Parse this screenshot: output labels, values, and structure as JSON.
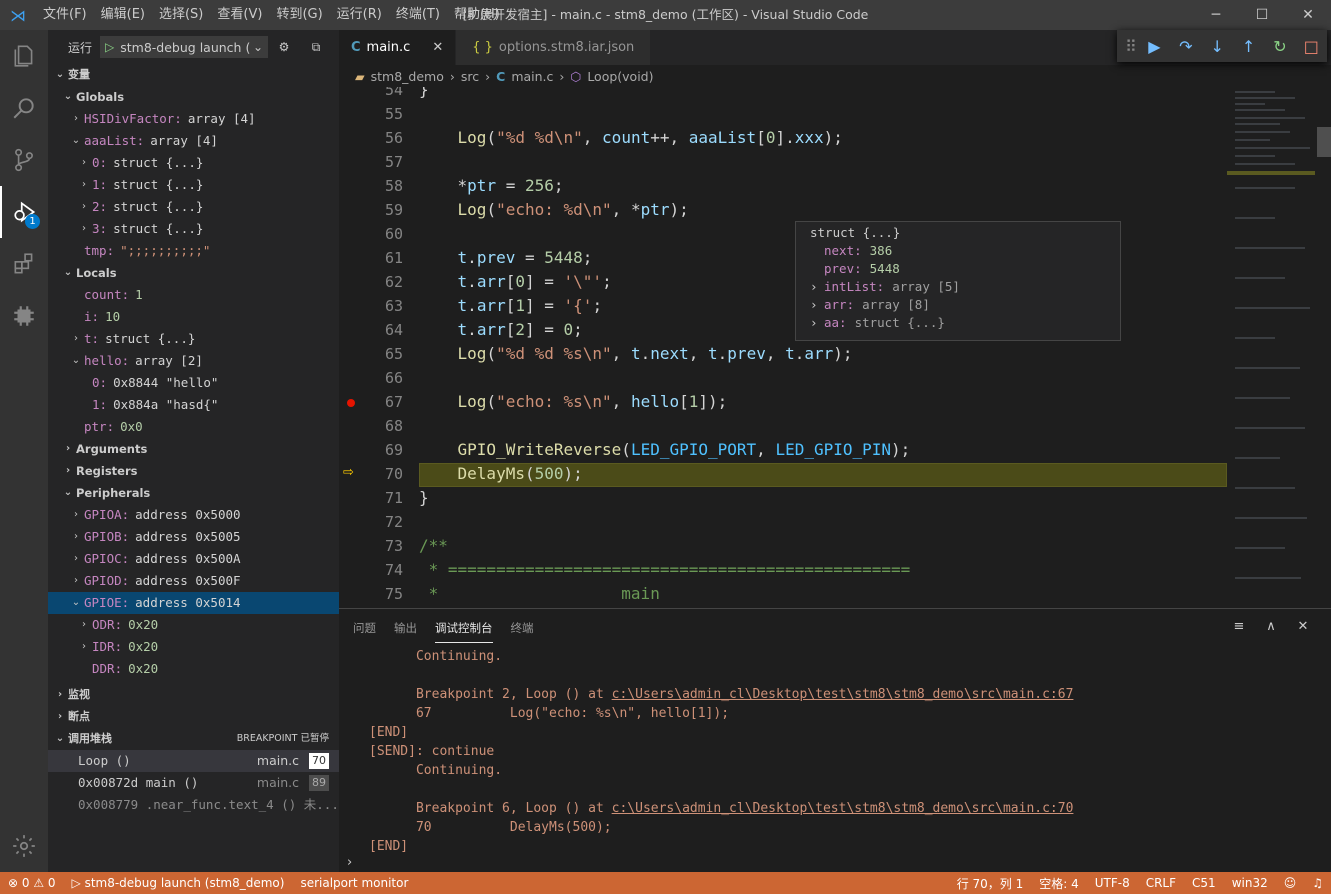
{
  "menu": [
    "文件(F)",
    "编辑(E)",
    "选择(S)",
    "查看(V)",
    "转到(G)",
    "运行(R)",
    "终端(T)",
    "帮助(H)"
  ],
  "window_title": "[扩展开发宿主] - main.c - stm8_demo (工作区) - Visual Studio Code",
  "activity_badge": "1",
  "run": {
    "label": "运行",
    "config": "stm8-debug launch ("
  },
  "variables": {
    "header": "变量",
    "rows": [
      {
        "chev": "⌄",
        "indent": 0,
        "type": "grp",
        "name": "Globals"
      },
      {
        "chev": "›",
        "indent": 1,
        "name": "HSIDivFactor:",
        "value": "array [4]"
      },
      {
        "chev": "⌄",
        "indent": 1,
        "name": "aaaList:",
        "value": "array [4]"
      },
      {
        "chev": "›",
        "indent": 2,
        "name": "0:",
        "value": "struct {...}"
      },
      {
        "chev": "›",
        "indent": 2,
        "name": "1:",
        "value": "struct {...}"
      },
      {
        "chev": "›",
        "indent": 2,
        "name": "2:",
        "value": "struct {...}"
      },
      {
        "chev": "›",
        "indent": 2,
        "name": "3:",
        "value": "struct {...}"
      },
      {
        "chev": "",
        "indent": 1,
        "name": "tmp:",
        "value": "\";;;;;;;;;;\"",
        "vc": "str"
      },
      {
        "chev": "⌄",
        "indent": 0,
        "type": "grp",
        "name": "Locals"
      },
      {
        "chev": "",
        "indent": 1,
        "name": "count:",
        "value": "1",
        "vc": "num"
      },
      {
        "chev": "",
        "indent": 1,
        "name": "i:",
        "value": "10",
        "vc": "num"
      },
      {
        "chev": "›",
        "indent": 1,
        "name": "t:",
        "value": "struct {...}"
      },
      {
        "chev": "⌄",
        "indent": 1,
        "name": "hello:",
        "value": "array [2]"
      },
      {
        "chev": "",
        "indent": 2,
        "name": "0:",
        "value": "0x8844 \"hello\""
      },
      {
        "chev": "",
        "indent": 2,
        "name": "1:",
        "value": "0x884a \"hasd{\""
      },
      {
        "chev": "",
        "indent": 1,
        "name": "ptr:",
        "value": "0x0",
        "vc": "num"
      },
      {
        "chev": "›",
        "indent": 0,
        "type": "grp",
        "name": "Arguments"
      },
      {
        "chev": "›",
        "indent": 0,
        "type": "grp",
        "name": "Registers"
      },
      {
        "chev": "⌄",
        "indent": 0,
        "type": "grp",
        "name": "Peripherals"
      },
      {
        "chev": "›",
        "indent": 1,
        "name": "GPIOA:",
        "value": "address 0x5000"
      },
      {
        "chev": "›",
        "indent": 1,
        "name": "GPIOB:",
        "value": "address 0x5005"
      },
      {
        "chev": "›",
        "indent": 1,
        "name": "GPIOC:",
        "value": "address 0x500A"
      },
      {
        "chev": "›",
        "indent": 1,
        "name": "GPIOD:",
        "value": "address 0x500F"
      },
      {
        "chev": "⌄",
        "indent": 1,
        "name": "GPIOE:",
        "value": "address 0x5014",
        "sel": true
      },
      {
        "chev": "›",
        "indent": 2,
        "name": "ODR:",
        "value": "0x20",
        "vc": "num"
      },
      {
        "chev": "›",
        "indent": 2,
        "name": "IDR:",
        "value": "0x20",
        "vc": "num"
      },
      {
        "chev": "",
        "indent": 2,
        "name": "DDR:",
        "value": "0x20",
        "vc": "num"
      }
    ]
  },
  "watch_header": "监视",
  "breakpoints_header": "断点",
  "callstack": {
    "header": "调用堆栈",
    "status": "BREAKPOINT 已暂停",
    "frames": [
      {
        "name": "Loop ()",
        "file": "main.c",
        "line": "70"
      },
      {
        "name": "0x00872d main ()",
        "file": "main.c",
        "line": "89"
      },
      {
        "name": "0x008779 .near_func.text_4 () 未...",
        "file": "",
        "line": ""
      }
    ]
  },
  "tabs": [
    {
      "label": "main.c",
      "icon": "C",
      "active": true
    },
    {
      "label": "options.stm8.iar.json",
      "icon": "{ }",
      "active": false
    }
  ],
  "breadcrumb": [
    "stm8_demo",
    "src",
    "main.c",
    "Loop(void)"
  ],
  "code_lines": [
    {
      "n": "54",
      "t": "}"
    },
    {
      "n": "55",
      "t": ""
    },
    {
      "n": "56",
      "t": "    Log(\"%d %d\\n\", count++, aaaList[0].xxx);"
    },
    {
      "n": "57",
      "t": ""
    },
    {
      "n": "58",
      "t": "    *ptr = 256;"
    },
    {
      "n": "59",
      "t": "    Log(\"echo: %d\\n\", *ptr);"
    },
    {
      "n": "60",
      "t": ""
    },
    {
      "n": "61",
      "t": "    t.prev = 5448;"
    },
    {
      "n": "62",
      "t": "    t.arr[0] = '\\\"';"
    },
    {
      "n": "63",
      "t": "    t.arr[1] = '{';"
    },
    {
      "n": "64",
      "t": "    t.arr[2] = 0;"
    },
    {
      "n": "65",
      "t": "    Log(\"%d %d %s\\n\", t.next, t.prev, t.arr);"
    },
    {
      "n": "66",
      "t": ""
    },
    {
      "n": "67",
      "t": "    Log(\"echo: %s\\n\", hello[1]);",
      "bp": true
    },
    {
      "n": "68",
      "t": ""
    },
    {
      "n": "69",
      "t": "    GPIO_WriteReverse(LED_GPIO_PORT, LED_GPIO_PIN);"
    },
    {
      "n": "70",
      "t": "    DelayMs(500);",
      "cur": true
    },
    {
      "n": "71",
      "t": "}"
    },
    {
      "n": "72",
      "t": ""
    },
    {
      "n": "73",
      "t": "/**"
    },
    {
      "n": "74",
      "t": " * ================================================"
    },
    {
      "n": "75",
      "t": " *                   main"
    }
  ],
  "hover": {
    "title": "struct {...}",
    "rows": [
      {
        "chev": "",
        "name": "next:",
        "value": "386"
      },
      {
        "chev": "",
        "name": "prev:",
        "value": "5448"
      },
      {
        "chev": "›",
        "name": "intList:",
        "value": "array [5]"
      },
      {
        "chev": "›",
        "name": "arr:",
        "value": "array [8]"
      },
      {
        "chev": "›",
        "name": "aa:",
        "value": "struct {...}"
      }
    ]
  },
  "panel_tabs": [
    "问题",
    "输出",
    "调试控制台",
    "终端"
  ],
  "console": [
    {
      "t": "      Continuing.",
      "c": "o"
    },
    {
      "t": "",
      "c": ""
    },
    {
      "t": "      Breakpoint 2, Loop () at ",
      "c": "o",
      "link": "c:\\Users\\admin_cl\\Desktop\\test\\stm8\\stm8_demo\\src\\main.c:67"
    },
    {
      "t": "      67          Log(\"echo: %s\\n\", hello[1]);",
      "c": "o"
    },
    {
      "t": "[END]",
      "c": "o"
    },
    {
      "t": "[SEND]: continue",
      "c": "o"
    },
    {
      "t": "      Continuing.",
      "c": "o"
    },
    {
      "t": "",
      "c": ""
    },
    {
      "t": "      Breakpoint 6, Loop () at ",
      "c": "o",
      "link": "c:\\Users\\admin_cl\\Desktop\\test\\stm8\\stm8_demo\\src\\main.c:70"
    },
    {
      "t": "      70          DelayMs(500);",
      "c": "o"
    },
    {
      "t": "[END]",
      "c": "o"
    }
  ],
  "status": {
    "errors": "⊗ 0 ⚠ 0",
    "launch": "▷ stm8-debug launch (stm8_demo)",
    "serial": "serialport monitor",
    "position": "行 70，列 1",
    "spaces": "空格: 4",
    "encoding": "UTF-8",
    "eol": "CRLF",
    "lang": "C51",
    "platform": "win32"
  }
}
